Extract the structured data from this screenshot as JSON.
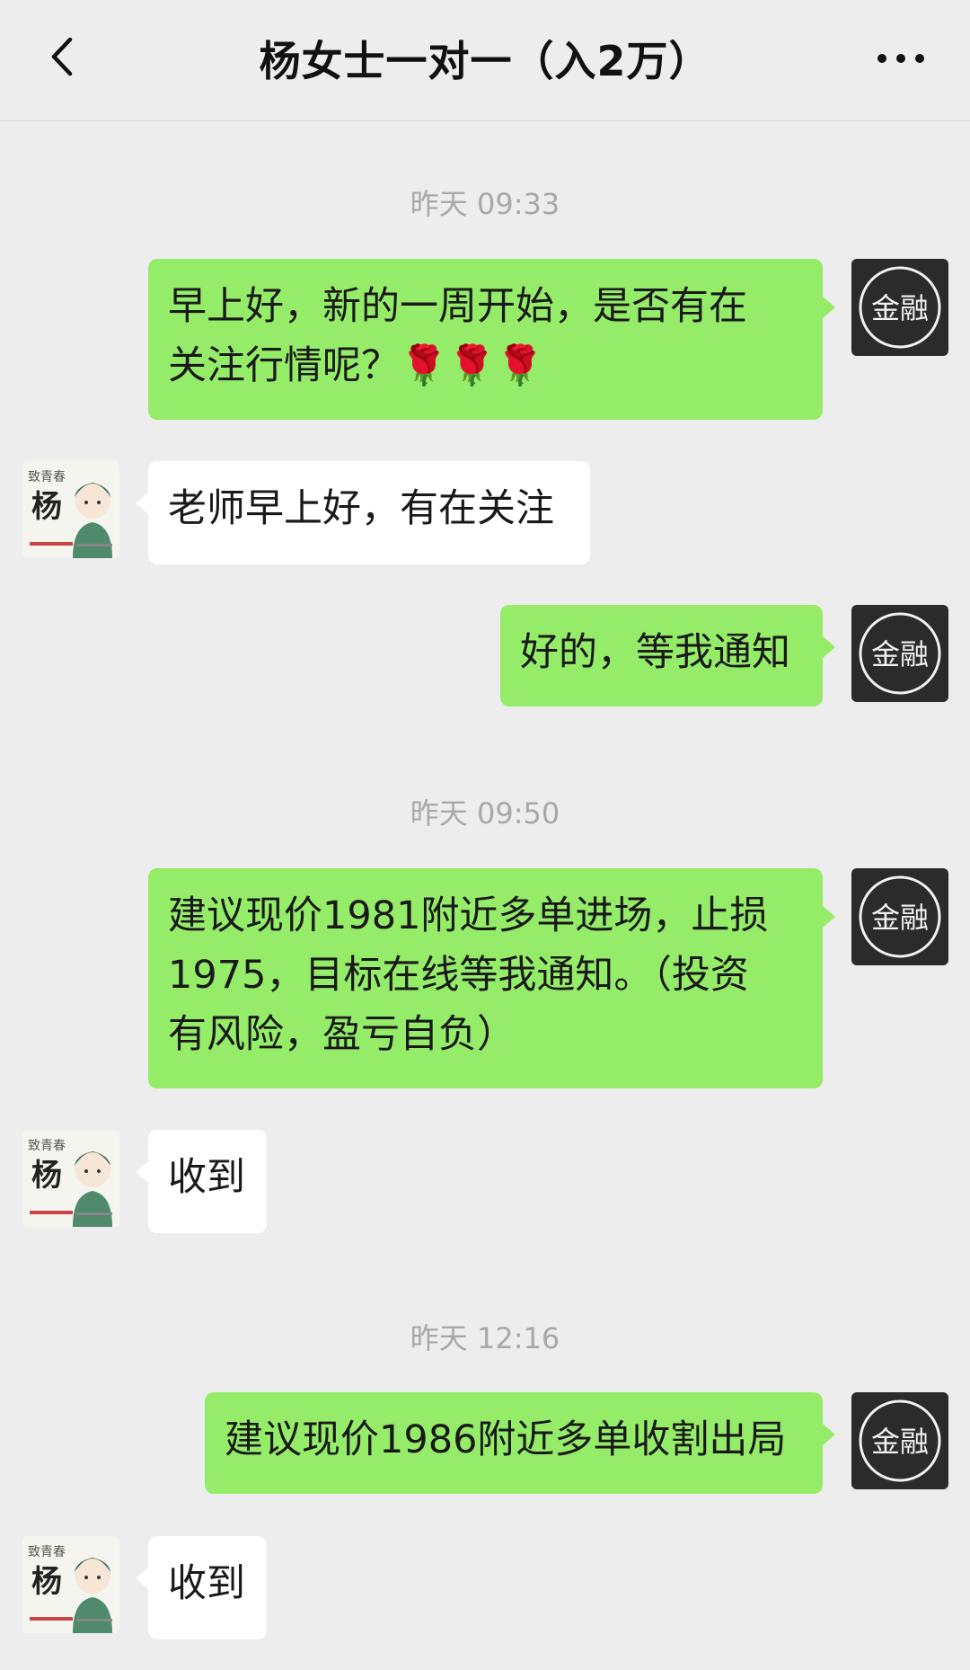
{
  "header": {
    "back_icon": "chevron-left-icon",
    "title": "杨女士一对一（入2万）",
    "more_icon": "ellipsis-icon"
  },
  "finance_avatar_text": "金融",
  "timestamps": [
    "昨天 09:33",
    "昨天 09:50",
    "昨天 12:16"
  ],
  "messages": [
    {
      "from": "self",
      "lines": [
        "早上好，新的一周开始，是否有在",
        "关注行情呢？🌹🌹🌹"
      ]
    },
    {
      "from": "other",
      "lines": [
        "老师早上好，有在关注"
      ]
    },
    {
      "from": "self",
      "lines": [
        "好的，等我通知"
      ]
    },
    {
      "from": "self",
      "lines": [
        "建议现价1981附近多单进场，止损",
        "1975，目标在线等我通知。（投资",
        "有风险，盈亏自负）"
      ]
    },
    {
      "from": "other",
      "lines": [
        "收到"
      ]
    },
    {
      "from": "self",
      "lines": [
        "建议现价1986附近多单收割出局"
      ]
    },
    {
      "from": "other",
      "lines": [
        "收到"
      ]
    }
  ],
  "user_avatar_text": [
    "致青春",
    "杨"
  ],
  "colors": {
    "background": "#ededed",
    "outgoing_bubble": "#95ec69",
    "incoming_bubble": "#ffffff",
    "timestamp": "#a8a8a8"
  }
}
